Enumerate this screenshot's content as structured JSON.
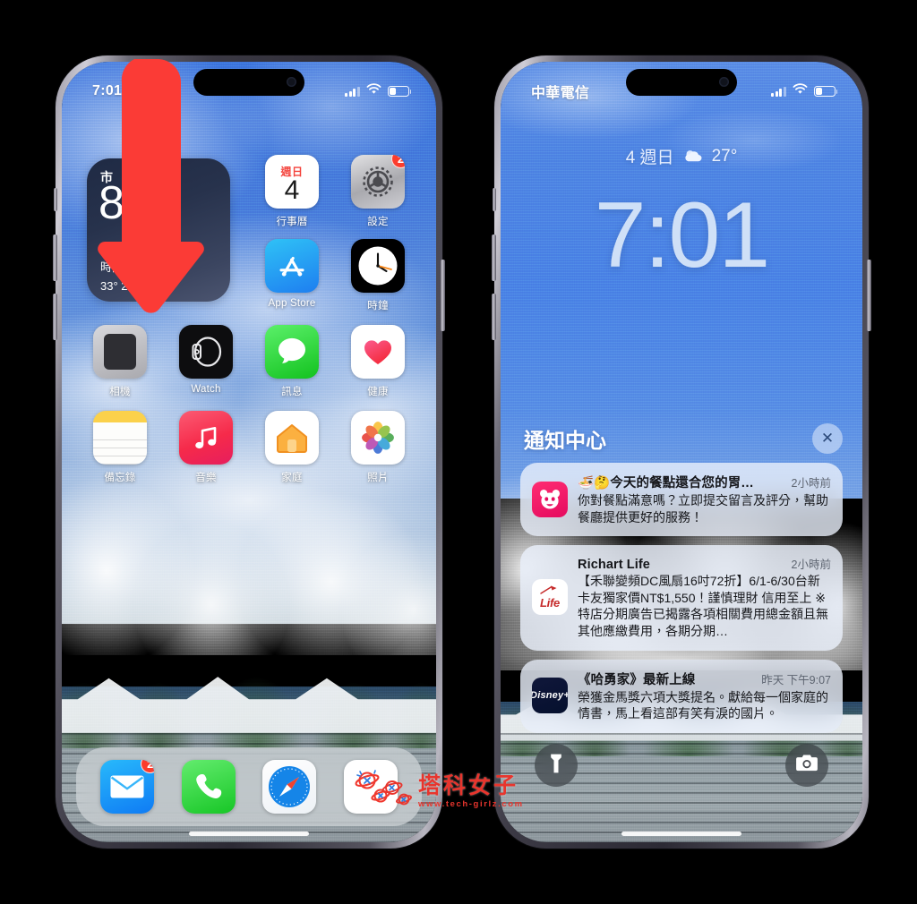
{
  "left_phone": {
    "name": "iphone-home-screen",
    "status_bar": {
      "time": "7:01",
      "signal": "signal-bars-icon",
      "wifi": "wifi-icon",
      "battery": "battery-icon"
    },
    "weather_widget": {
      "city": "市",
      "temperature": "8°",
      "condition": "時陰",
      "range": "33°  26°"
    },
    "apps": [
      {
        "label": "行事曆",
        "icon": "calendar-icon",
        "badge": "",
        "cal_weekday": "週日",
        "cal_day": "4"
      },
      {
        "label": "設定",
        "icon": "settings-gear-icon",
        "badge": "2"
      },
      {
        "label": "App Store",
        "icon": "app-store-icon",
        "badge": ""
      },
      {
        "label": "時鐘",
        "icon": "clock-icon",
        "badge": ""
      },
      {
        "label": "相機",
        "icon": "camera-icon",
        "badge": ""
      },
      {
        "label": "Watch",
        "icon": "apple-watch-icon",
        "badge": ""
      },
      {
        "label": "訊息",
        "icon": "messages-icon",
        "badge": ""
      },
      {
        "label": "健康",
        "icon": "health-heart-icon",
        "badge": ""
      },
      {
        "label": "備忘錄",
        "icon": "notes-icon",
        "badge": ""
      },
      {
        "label": "音樂",
        "icon": "music-note-icon",
        "badge": ""
      },
      {
        "label": "家庭",
        "icon": "home-house-icon",
        "badge": ""
      },
      {
        "label": "照片",
        "icon": "photos-flower-icon",
        "badge": ""
      }
    ],
    "dock": [
      {
        "label": "Mail",
        "icon": "mail-envelope-icon",
        "badge": "2"
      },
      {
        "label": "Phone",
        "icon": "phone-handset-icon",
        "badge": ""
      },
      {
        "label": "Safari",
        "icon": "safari-compass-icon",
        "badge": ""
      },
      {
        "label": "Tech Girlz",
        "icon": "tech-girlz-planet-icon",
        "badge": ""
      }
    ]
  },
  "right_phone": {
    "name": "iphone-lock-screen",
    "status_bar": {
      "carrier": "中華電信",
      "signal": "signal-bars-icon",
      "wifi": "wifi-icon",
      "battery": "battery-icon"
    },
    "lock": {
      "date": "4 週日",
      "weather_icon": "partly-cloudy-icon",
      "weather_temp": "27°",
      "time": "7:01"
    },
    "notification_center": {
      "title": "通知中心",
      "close_label": "✕",
      "notifications": [
        {
          "app_icon": "foodpanda-icon",
          "title": "🍜🤔今天的餐點還合您的胃…",
          "time": "2小時前",
          "body": "你對餐點滿意嗎？立即提交留言及評分，幫助餐廳提供更好的服務！"
        },
        {
          "app_icon": "richart-life-icon",
          "icon_text": "Life",
          "title": "Richart Life",
          "time": "2小時前",
          "body": "【禾聯變頻DC風扇16吋72折】6/1-6/30台新卡友獨家價NT$1,550！謹慎理財 信用至上 ※特店分期廣告已揭露各項相關費用總金額且無其他應繳費用，各期分期…"
        },
        {
          "app_icon": "disney-plus-icon",
          "icon_text": "Disney+",
          "title": "《哈勇家》最新上線",
          "time": "昨天 下午9:07",
          "body": "榮獲金馬獎六項大獎提名。獻給每一個家庭的情書，馬上看這部有笑有淚的國片。"
        }
      ]
    },
    "actions": [
      {
        "name": "flashlight-button",
        "icon": "flashlight-icon"
      },
      {
        "name": "camera-button",
        "icon": "camera-icon"
      }
    ]
  },
  "annotation": {
    "arrow": {
      "name": "swipe-down-arrow",
      "color": "#fb3b36",
      "direction": "down"
    }
  },
  "watermark": {
    "brand": "塔科女子",
    "url": "www.tech-girlz.com",
    "color": "#e8352d"
  }
}
